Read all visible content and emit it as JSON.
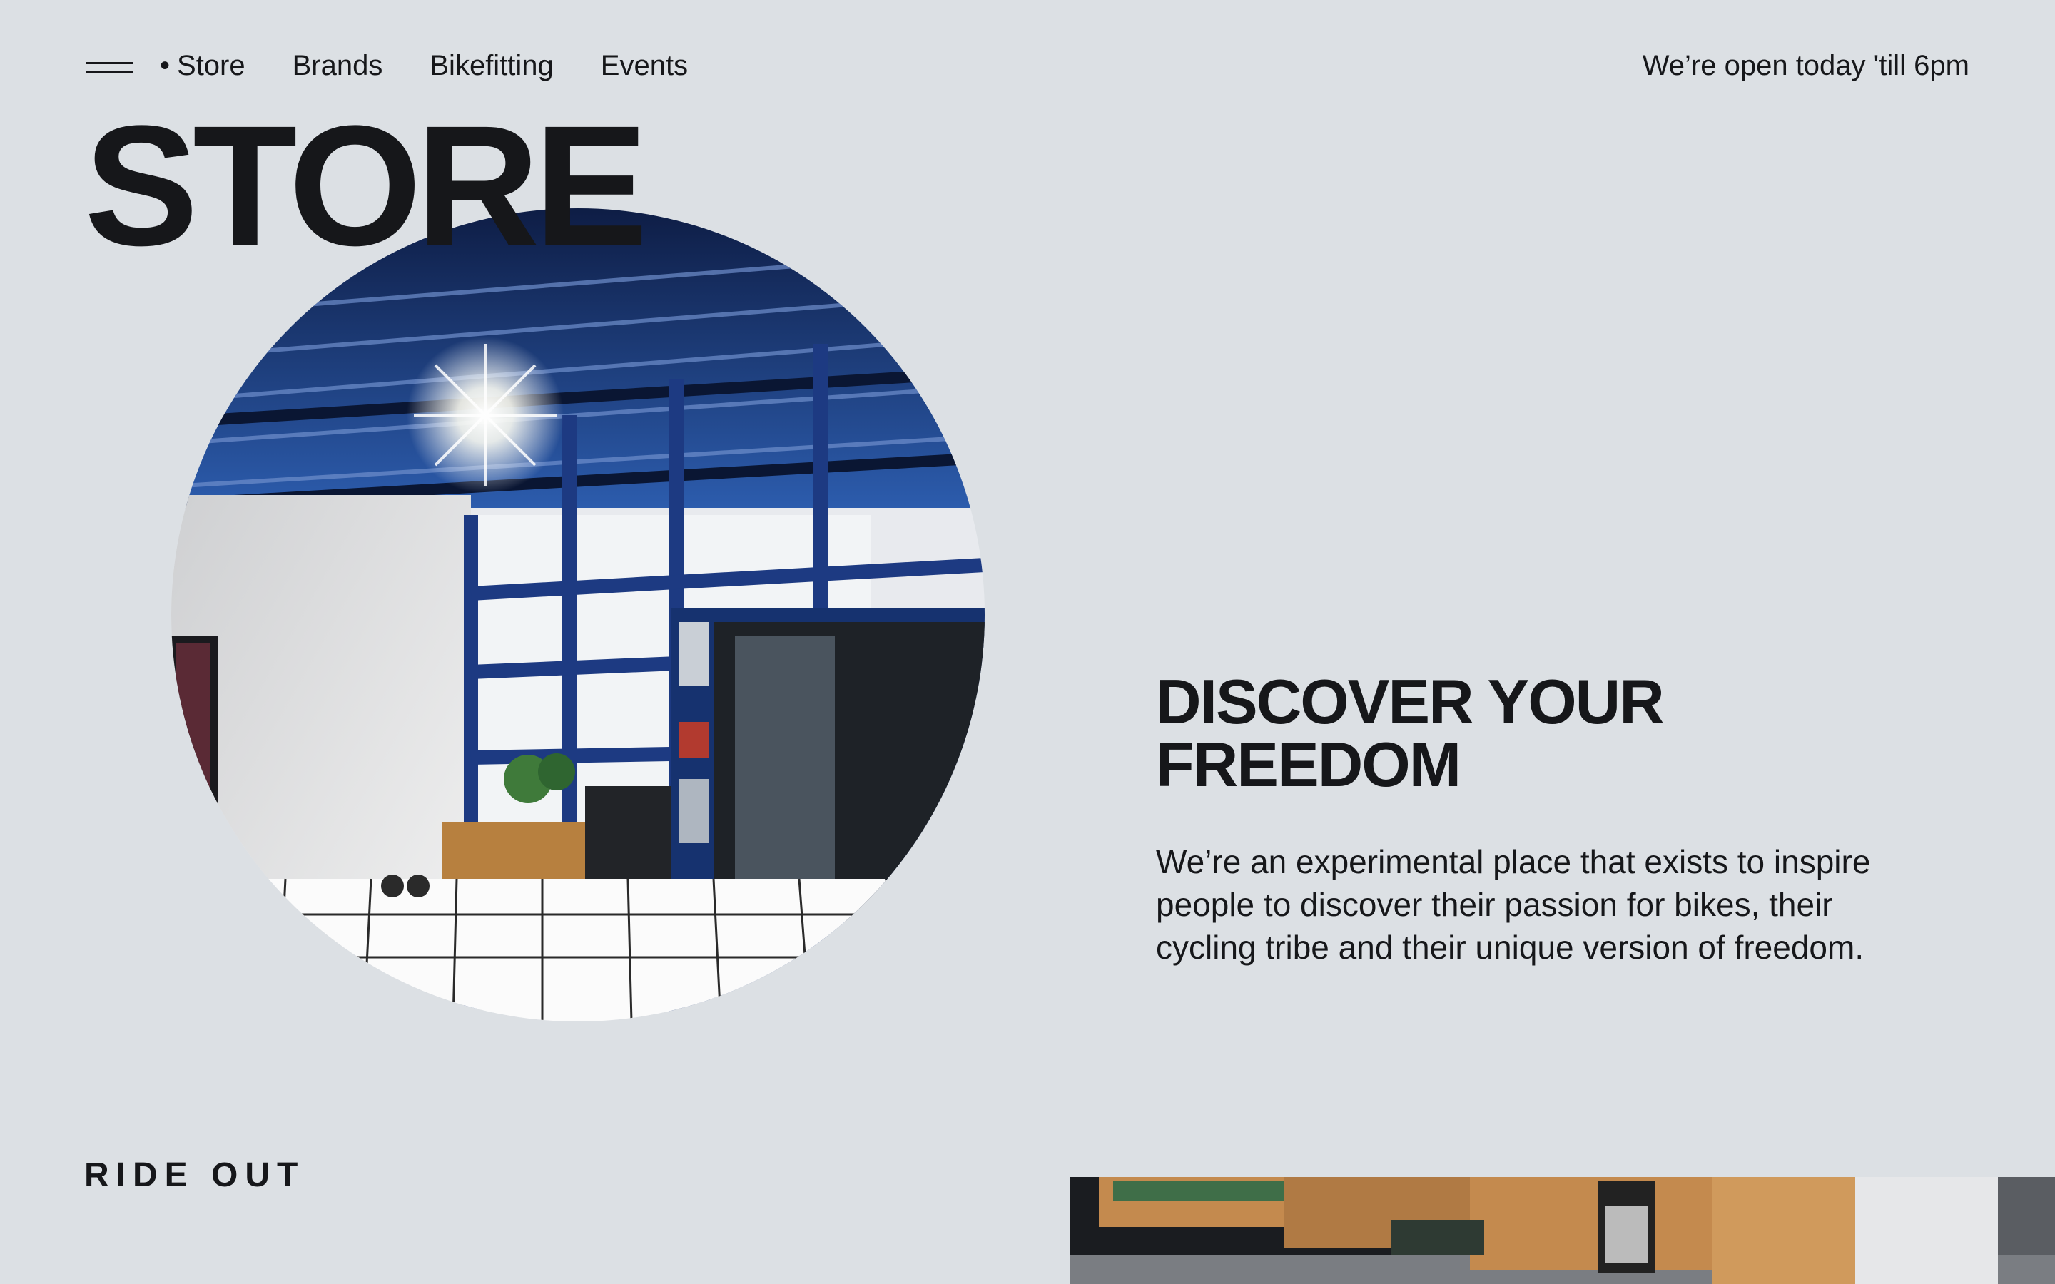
{
  "header": {
    "menu_icon": "hamburger-menu-icon",
    "nav_items": [
      {
        "label": "Store",
        "active": true
      },
      {
        "label": "Brands",
        "active": false
      },
      {
        "label": "Bikefitting",
        "active": false
      },
      {
        "label": "Events",
        "active": false
      }
    ],
    "open_text": "We’re open today 'till 6pm"
  },
  "page_title": "STORE",
  "hero": {
    "headline_line1": "DISCOVER YOUR",
    "headline_line2": "FREEDOM",
    "body": "We’re an experimental place that exists to inspire people to discover their passion for bikes, their cycling tribe and their unique version of freedom."
  },
  "section": {
    "label": "RIDE OUT"
  },
  "colors": {
    "background": "#dce0e4",
    "text": "#16171a",
    "steel_blue": "#1f3f86",
    "wood": "#c48a4e"
  }
}
